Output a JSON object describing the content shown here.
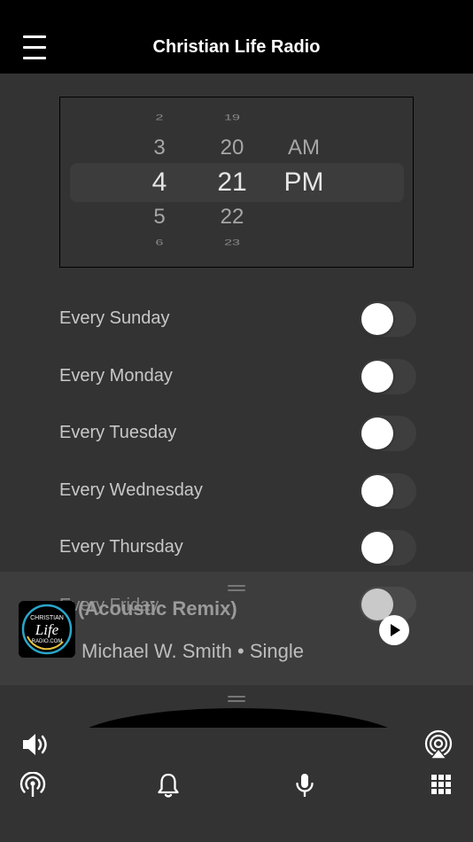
{
  "header": {
    "title": "Christian Life Radio"
  },
  "picker": {
    "hours": [
      "2",
      "3",
      "4",
      "5",
      "6"
    ],
    "minutes": [
      "19",
      "20",
      "21",
      "22",
      "23"
    ],
    "periods": [
      "AM",
      "PM"
    ]
  },
  "days": [
    {
      "label": "Every Sunday",
      "on": false
    },
    {
      "label": "Every Monday",
      "on": false
    },
    {
      "label": "Every Tuesday",
      "on": false
    },
    {
      "label": "Every Wednesday",
      "on": false
    },
    {
      "label": "Every Thursday",
      "on": false
    },
    {
      "label": "Every Friday",
      "on": false
    }
  ],
  "player": {
    "title": "(Acoustic Remix)",
    "subtitle": "Michael W. Smith • Single",
    "artwork_text": "CHRISTIAN Life RADIO.COM"
  },
  "toolbar": {
    "icons": [
      "speaker-icon",
      "airplay-icon",
      "broadcast-icon",
      "bell-icon",
      "microphone-icon",
      "grid-icon"
    ]
  },
  "colors": {
    "background": "#333333",
    "header": "#000000",
    "toggle_off": "#3e3e3e"
  }
}
